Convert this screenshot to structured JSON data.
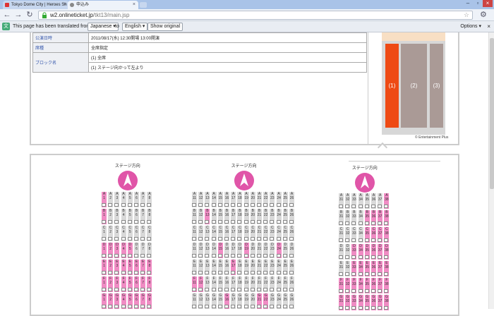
{
  "browser": {
    "tabs": [
      {
        "title": "Tokyo Dome City | Heroes Sh"
      },
      {
        "title": "申込み"
      }
    ],
    "url_domain": "w2.onlineticket.jp",
    "url_path": "/tkt13/main.jsp"
  },
  "translate_bar": {
    "message": "This page has been translated from",
    "from_lang": "Japanese",
    "to_label": "to",
    "to_lang": "English",
    "show_original": "Show original",
    "options": "Options",
    "close": "×"
  },
  "info_table": [
    {
      "key": "公演日時",
      "value": "2011/08/17(水) 12:30開場 13:00開演"
    },
    {
      "key": "席種",
      "value": "全席指定"
    },
    {
      "key": "ブロック名",
      "value": "(1) 全席"
    },
    {
      "key": "",
      "value": "(1) ステージ向かって左より"
    }
  ],
  "map": {
    "blocks": [
      {
        "label": "(1)"
      },
      {
        "label": "(2)"
      },
      {
        "label": "(3)"
      }
    ],
    "copyright": "© Entertainment Plus"
  },
  "seat_map": {
    "sections": [
      {
        "direction_label": "ステージ方向",
        "rows": [
          {
            "row": "A",
            "seats": [
              "1",
              "2",
              "3",
              "4",
              "5",
              "6",
              "7",
              "8"
            ],
            "pink": [
              0
            ]
          },
          {
            "row": "B",
            "seats": [
              "1",
              "2",
              "3",
              "4",
              "5",
              "6",
              "7",
              "8"
            ],
            "pink": [
              0
            ]
          },
          {
            "row": "C",
            "seats": [
              "1",
              "2",
              "3",
              "4",
              "5",
              "6",
              "7",
              "8"
            ],
            "pink": []
          },
          {
            "row": "D",
            "seats": [
              "1",
              "2",
              "3",
              "4",
              "5",
              "6",
              "7",
              "8"
            ],
            "pink": [
              0,
              1,
              2,
              3,
              4
            ]
          },
          {
            "row": "E",
            "seats": [
              "1",
              "2",
              "3",
              "4",
              "5",
              "6",
              "7",
              "8"
            ],
            "pink": [
              0,
              1,
              2,
              3,
              4,
              5,
              6,
              7
            ]
          },
          {
            "row": "F",
            "seats": [
              "1",
              "2",
              "3",
              "4",
              "5",
              "6",
              "7",
              "8"
            ],
            "pink": [
              0,
              1,
              2,
              3,
              4,
              5,
              6,
              7
            ]
          },
          {
            "row": "G",
            "seats": [
              "1",
              "2",
              "3",
              "4",
              "5",
              "6",
              "7",
              "8"
            ],
            "pink": [
              0,
              1,
              2,
              3,
              4,
              5,
              6,
              7
            ]
          }
        ]
      },
      {
        "direction_label": "ステージ方向",
        "rows": [
          {
            "row": "A",
            "seats": [
              "11",
              "12",
              "13",
              "14",
              "15",
              "16",
              "17",
              "18",
              "19",
              "20",
              "21",
              "22",
              "23",
              "24",
              "25",
              "26"
            ],
            "pink": []
          },
          {
            "row": "B",
            "seats": [
              "11",
              "12",
              "13",
              "14",
              "15",
              "16",
              "17",
              "18",
              "19",
              "20",
              "21",
              "22",
              "23",
              "24",
              "25",
              "26"
            ],
            "pink": [
              2
            ]
          },
          {
            "row": "C",
            "seats": [
              "11",
              "12",
              "13",
              "14",
              "15",
              "16",
              "17",
              "18",
              "19",
              "20",
              "21",
              "22",
              "23",
              "24",
              "25",
              "26"
            ],
            "pink": []
          },
          {
            "row": "D",
            "seats": [
              "11",
              "12",
              "13",
              "14",
              "15",
              "16",
              "17",
              "18",
              "19",
              "20",
              "21",
              "22",
              "23",
              "24",
              "25",
              "26"
            ],
            "pink": [
              4,
              8,
              13
            ]
          },
          {
            "row": "E",
            "seats": [
              "11",
              "12",
              "13",
              "14",
              "15",
              "16",
              "17",
              "18",
              "19",
              "20",
              "21",
              "22",
              "23",
              "24",
              "25",
              "26"
            ],
            "pink": [
              6
            ]
          },
          {
            "row": "F",
            "seats": [
              "11",
              "12",
              "13",
              "14",
              "15",
              "16",
              "17",
              "18",
              "19",
              "20",
              "21",
              "22",
              "23",
              "24",
              "25",
              "26"
            ],
            "pink": [
              0,
              1
            ]
          },
          {
            "row": "G",
            "seats": [
              "11",
              "12",
              "13",
              "14",
              "15",
              "16",
              "17",
              "18",
              "19",
              "20",
              "21",
              "22",
              "23",
              "24",
              "25",
              "26"
            ],
            "pink": [
              5,
              10,
              11
            ]
          }
        ]
      },
      {
        "direction_label": "ステージ方向",
        "rows": [
          {
            "row": "A",
            "seats": [
              "31",
              "32",
              "33",
              "34",
              "35",
              "36",
              "37",
              "38"
            ],
            "pink": [
              7
            ]
          },
          {
            "row": "B",
            "seats": [
              "31",
              "32",
              "33",
              "34",
              "35",
              "36",
              "37",
              "38"
            ],
            "pink": [
              4,
              5,
              6,
              7
            ]
          },
          {
            "row": "C",
            "seats": [
              "31",
              "32",
              "33",
              "34",
              "35",
              "36",
              "37",
              "38"
            ],
            "pink": [
              4,
              5,
              6,
              7
            ]
          },
          {
            "row": "D",
            "seats": [
              "31",
              "32",
              "33",
              "34",
              "35",
              "36",
              "37",
              "38"
            ],
            "pink": [
              2,
              3,
              4,
              5,
              6,
              7
            ]
          },
          {
            "row": "E",
            "seats": [
              "31",
              "32",
              "33",
              "34",
              "35",
              "36",
              "37",
              "38"
            ],
            "pink": [
              2,
              3,
              4,
              5,
              6,
              7
            ]
          },
          {
            "row": "F",
            "seats": [
              "31",
              "32",
              "33",
              "34",
              "35",
              "36",
              "37",
              "38"
            ],
            "pink": [
              0,
              1,
              2,
              3,
              4,
              5,
              6,
              7
            ]
          },
          {
            "row": "G",
            "seats": [
              "31",
              "32",
              "33",
              "34",
              "35",
              "36",
              "37",
              "38"
            ],
            "pink": [
              0,
              1,
              2,
              3,
              4,
              5,
              6,
              7
            ]
          }
        ]
      }
    ]
  },
  "colors": {
    "available_seat": "#f08cc4",
    "taken_seat": "#d9d9d9",
    "selected_block": "#ee4a14"
  }
}
